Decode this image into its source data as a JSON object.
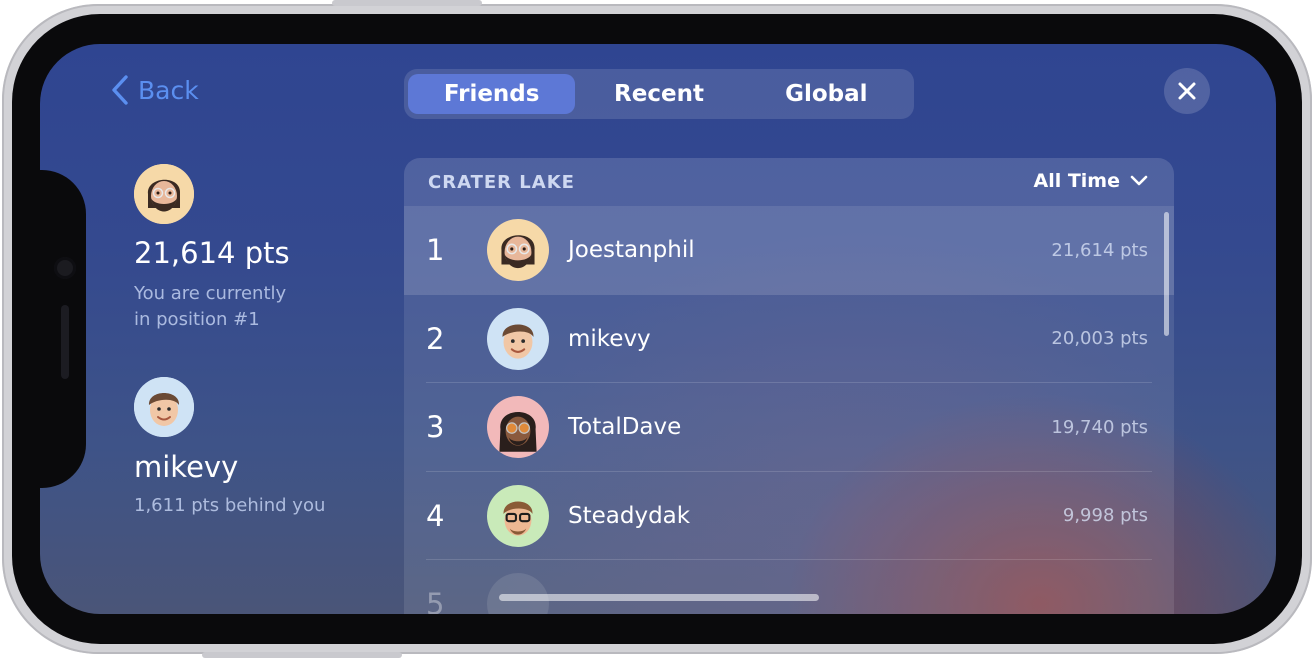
{
  "nav": {
    "back_label": "Back",
    "tabs": [
      {
        "label": "Friends",
        "active": true
      },
      {
        "label": "Recent",
        "active": false
      },
      {
        "label": "Global",
        "active": false
      }
    ],
    "close_icon": "close-icon"
  },
  "summary": {
    "points": "21,614 pts",
    "position_line1": "You are currently",
    "position_line2": "in position #1",
    "rival_name": "mikevy",
    "rival_gap": "1,611 pts behind you"
  },
  "leaderboard": {
    "title": "CRATER LAKE",
    "filter_label": "All Time",
    "rows": [
      {
        "rank": "1",
        "name": "Joestanphil",
        "points": "21,614 pts",
        "avatar": "bearded-glasses-avatar",
        "avatar_bg": "#f6d9a8"
      },
      {
        "rank": "2",
        "name": "mikevy",
        "points": "20,003 pts",
        "avatar": "young-man-avatar",
        "avatar_bg": "#cfe3f5"
      },
      {
        "rank": "3",
        "name": "TotalDave",
        "points": "19,740 pts",
        "avatar": "dreadlocks-sunglasses-avatar",
        "avatar_bg": "#f2b9ba"
      },
      {
        "rank": "4",
        "name": "Steadydak",
        "points": "9,998 pts",
        "avatar": "glasses-man-avatar",
        "avatar_bg": "#c9eab9"
      },
      {
        "rank": "5",
        "name": "",
        "points": "",
        "avatar": "partial-avatar",
        "avatar_bg": "#8d94a8"
      }
    ]
  },
  "colors": {
    "accent": "#5b8ff0",
    "segment_active": "#5d78d6"
  }
}
